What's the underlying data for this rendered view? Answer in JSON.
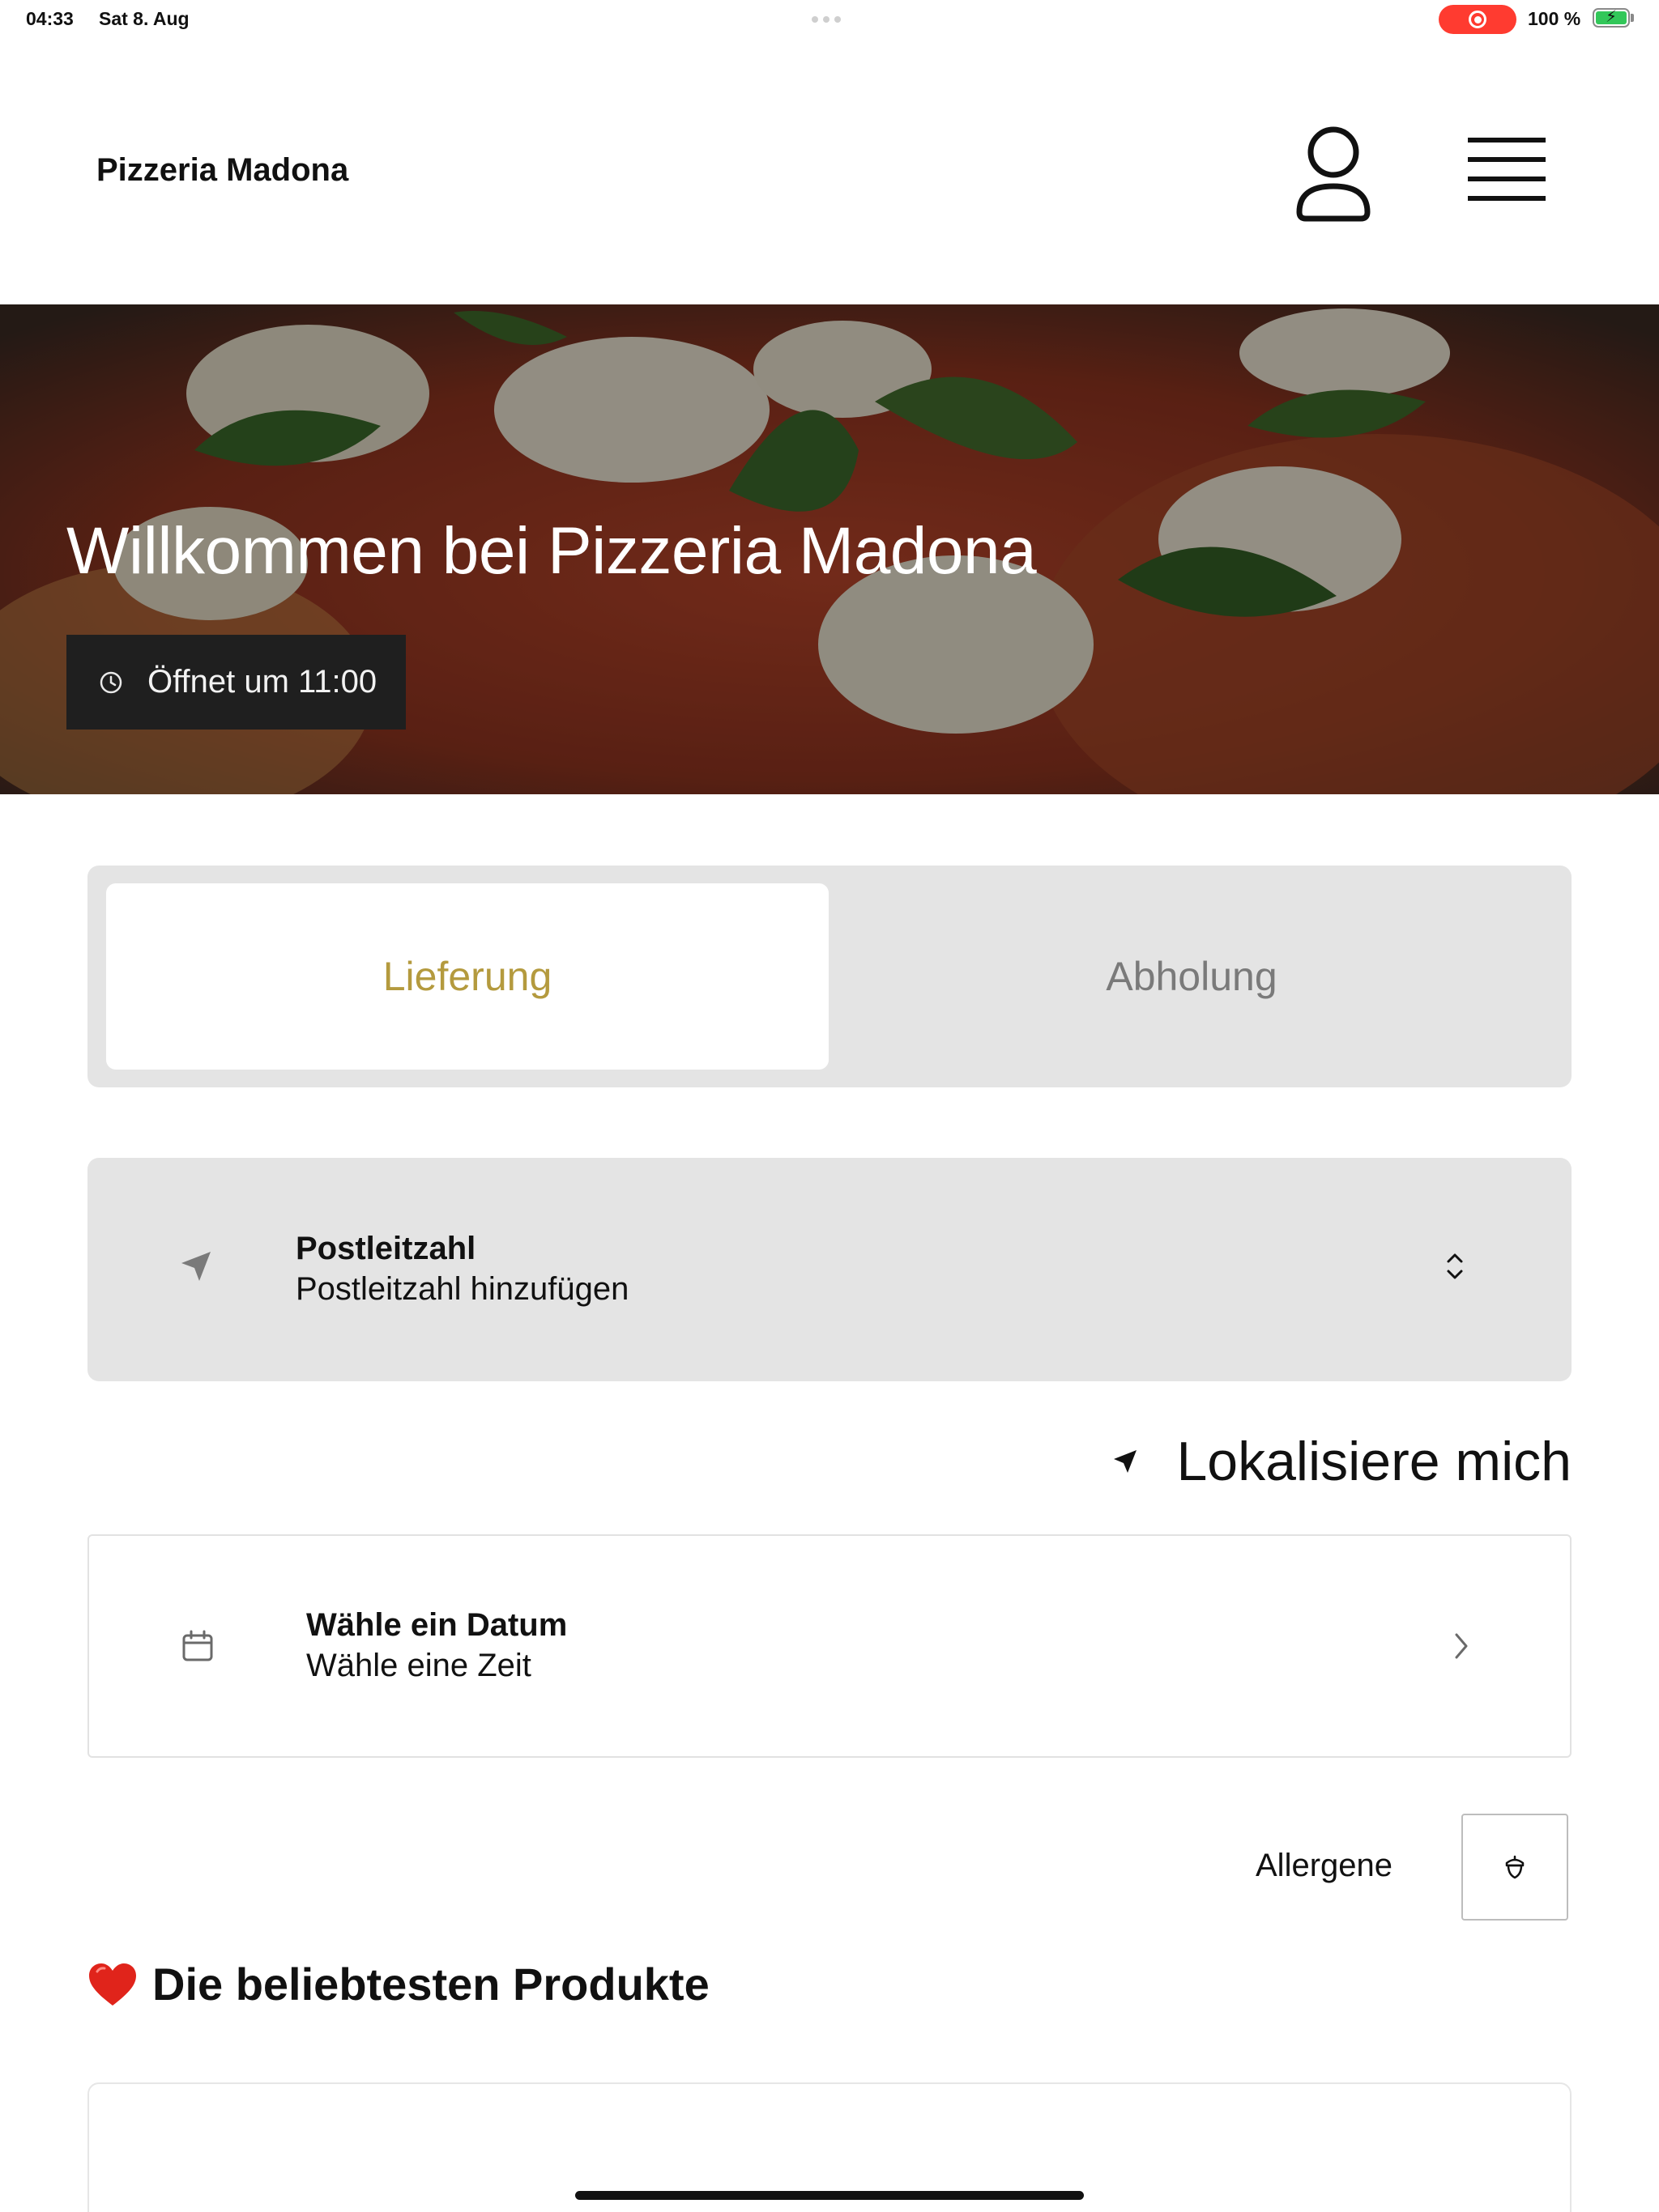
{
  "status_bar": {
    "time": "04:33",
    "date": "Sat 8. Aug",
    "battery": "100 %",
    "recording_color": "#ff3b30",
    "battery_color": "#32c759"
  },
  "header": {
    "brand": "Pizzeria Madona",
    "profile_icon": "person-icon",
    "menu_icon": "hamburger-icon"
  },
  "hero": {
    "title": "Willkommen bei Pizzeria Madona",
    "opening": "Öffnet um 11:00",
    "opening_icon": "clock-icon"
  },
  "order_type": {
    "options": [
      "Lieferung",
      "Abholung"
    ],
    "selected": "Lieferung",
    "active_color": "#b49a3e"
  },
  "postal_code": {
    "title": "Postleitzahl",
    "placeholder": "Postleitzahl hinzufügen",
    "icon": "location-arrow-icon",
    "trailing_icon": "chevron-up-down-icon"
  },
  "locate": {
    "label": "Lokalisiere mich",
    "icon": "location-arrow-icon"
  },
  "schedule": {
    "title": "Wähle ein Datum",
    "subtitle": "Wähle eine Zeit",
    "icon": "calendar-icon",
    "trailing_icon": "chevron-right-icon"
  },
  "allergens": {
    "label": "Allergene",
    "icon": "acorn-icon"
  },
  "popular": {
    "emoji": "❤️",
    "title": "Die beliebtesten Produkte"
  }
}
